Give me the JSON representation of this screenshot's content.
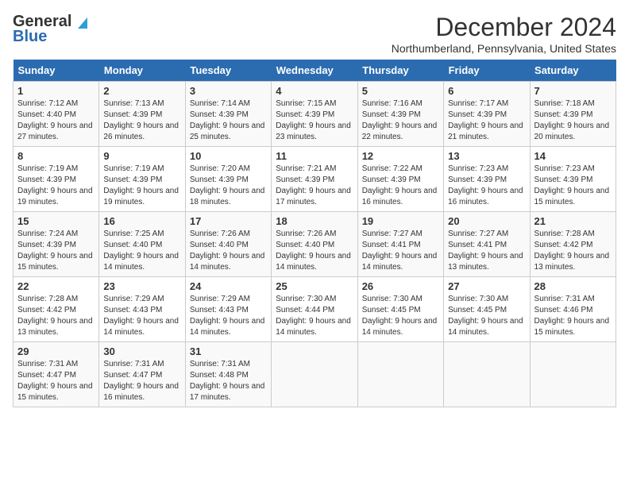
{
  "header": {
    "logo_general": "General",
    "logo_blue": "Blue",
    "month_year": "December 2024",
    "location": "Northumberland, Pennsylvania, United States"
  },
  "days_of_week": [
    "Sunday",
    "Monday",
    "Tuesday",
    "Wednesday",
    "Thursday",
    "Friday",
    "Saturday"
  ],
  "weeks": [
    [
      {
        "day": "1",
        "sunrise": "7:12 AM",
        "sunset": "4:40 PM",
        "daylight": "9 hours and 27 minutes."
      },
      {
        "day": "2",
        "sunrise": "7:13 AM",
        "sunset": "4:39 PM",
        "daylight": "9 hours and 26 minutes."
      },
      {
        "day": "3",
        "sunrise": "7:14 AM",
        "sunset": "4:39 PM",
        "daylight": "9 hours and 25 minutes."
      },
      {
        "day": "4",
        "sunrise": "7:15 AM",
        "sunset": "4:39 PM",
        "daylight": "9 hours and 23 minutes."
      },
      {
        "day": "5",
        "sunrise": "7:16 AM",
        "sunset": "4:39 PM",
        "daylight": "9 hours and 22 minutes."
      },
      {
        "day": "6",
        "sunrise": "7:17 AM",
        "sunset": "4:39 PM",
        "daylight": "9 hours and 21 minutes."
      },
      {
        "day": "7",
        "sunrise": "7:18 AM",
        "sunset": "4:39 PM",
        "daylight": "9 hours and 20 minutes."
      }
    ],
    [
      {
        "day": "8",
        "sunrise": "7:19 AM",
        "sunset": "4:39 PM",
        "daylight": "9 hours and 19 minutes."
      },
      {
        "day": "9",
        "sunrise": "7:19 AM",
        "sunset": "4:39 PM",
        "daylight": "9 hours and 19 minutes."
      },
      {
        "day": "10",
        "sunrise": "7:20 AM",
        "sunset": "4:39 PM",
        "daylight": "9 hours and 18 minutes."
      },
      {
        "day": "11",
        "sunrise": "7:21 AM",
        "sunset": "4:39 PM",
        "daylight": "9 hours and 17 minutes."
      },
      {
        "day": "12",
        "sunrise": "7:22 AM",
        "sunset": "4:39 PM",
        "daylight": "9 hours and 16 minutes."
      },
      {
        "day": "13",
        "sunrise": "7:23 AM",
        "sunset": "4:39 PM",
        "daylight": "9 hours and 16 minutes."
      },
      {
        "day": "14",
        "sunrise": "7:23 AM",
        "sunset": "4:39 PM",
        "daylight": "9 hours and 15 minutes."
      }
    ],
    [
      {
        "day": "15",
        "sunrise": "7:24 AM",
        "sunset": "4:39 PM",
        "daylight": "9 hours and 15 minutes."
      },
      {
        "day": "16",
        "sunrise": "7:25 AM",
        "sunset": "4:40 PM",
        "daylight": "9 hours and 14 minutes."
      },
      {
        "day": "17",
        "sunrise": "7:26 AM",
        "sunset": "4:40 PM",
        "daylight": "9 hours and 14 minutes."
      },
      {
        "day": "18",
        "sunrise": "7:26 AM",
        "sunset": "4:40 PM",
        "daylight": "9 hours and 14 minutes."
      },
      {
        "day": "19",
        "sunrise": "7:27 AM",
        "sunset": "4:41 PM",
        "daylight": "9 hours and 14 minutes."
      },
      {
        "day": "20",
        "sunrise": "7:27 AM",
        "sunset": "4:41 PM",
        "daylight": "9 hours and 13 minutes."
      },
      {
        "day": "21",
        "sunrise": "7:28 AM",
        "sunset": "4:42 PM",
        "daylight": "9 hours and 13 minutes."
      }
    ],
    [
      {
        "day": "22",
        "sunrise": "7:28 AM",
        "sunset": "4:42 PM",
        "daylight": "9 hours and 13 minutes."
      },
      {
        "day": "23",
        "sunrise": "7:29 AM",
        "sunset": "4:43 PM",
        "daylight": "9 hours and 14 minutes."
      },
      {
        "day": "24",
        "sunrise": "7:29 AM",
        "sunset": "4:43 PM",
        "daylight": "9 hours and 14 minutes."
      },
      {
        "day": "25",
        "sunrise": "7:30 AM",
        "sunset": "4:44 PM",
        "daylight": "9 hours and 14 minutes."
      },
      {
        "day": "26",
        "sunrise": "7:30 AM",
        "sunset": "4:45 PM",
        "daylight": "9 hours and 14 minutes."
      },
      {
        "day": "27",
        "sunrise": "7:30 AM",
        "sunset": "4:45 PM",
        "daylight": "9 hours and 14 minutes."
      },
      {
        "day": "28",
        "sunrise": "7:31 AM",
        "sunset": "4:46 PM",
        "daylight": "9 hours and 15 minutes."
      }
    ],
    [
      {
        "day": "29",
        "sunrise": "7:31 AM",
        "sunset": "4:47 PM",
        "daylight": "9 hours and 15 minutes."
      },
      {
        "day": "30",
        "sunrise": "7:31 AM",
        "sunset": "4:47 PM",
        "daylight": "9 hours and 16 minutes."
      },
      {
        "day": "31",
        "sunrise": "7:31 AM",
        "sunset": "4:48 PM",
        "daylight": "9 hours and 17 minutes."
      },
      null,
      null,
      null,
      null
    ]
  ],
  "labels": {
    "sunrise": "Sunrise:",
    "sunset": "Sunset:",
    "daylight": "Daylight:"
  }
}
